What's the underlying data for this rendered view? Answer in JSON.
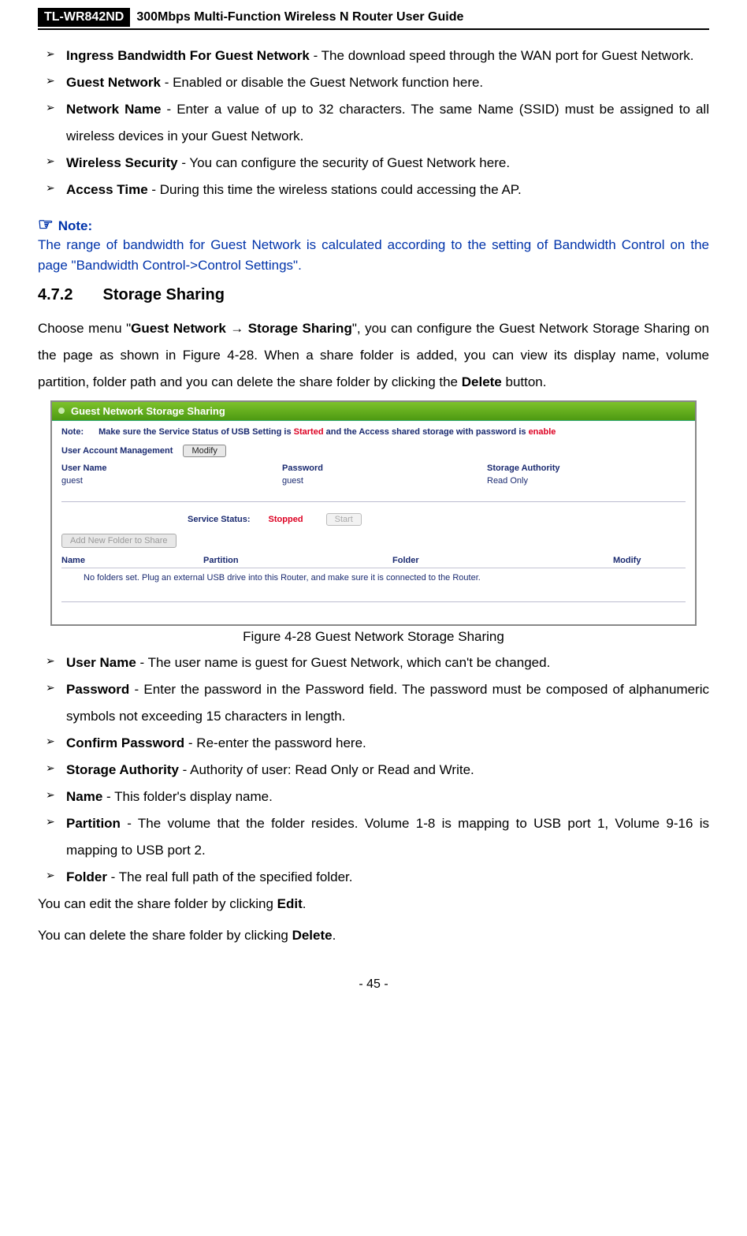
{
  "header": {
    "model": "TL-WR842ND",
    "title": "300Mbps Multi-Function Wireless N Router User Guide"
  },
  "list1": [
    {
      "term": "Ingress Bandwidth For Guest Network",
      "desc": " - The download speed through the WAN port for Guest Network."
    },
    {
      "term": "Guest Network",
      "desc": " - Enabled or disable the Guest Network function here."
    },
    {
      "term": "Network Name",
      "desc": " - Enter a value of up to 32 characters. The same Name (SSID) must be assigned to all wireless devices in your Guest Network."
    },
    {
      "term": "Wireless Security",
      "desc": " - You can configure the security of Guest Network here."
    },
    {
      "term": "Access Time",
      "desc": " - During this time the wireless stations could accessing the AP."
    }
  ],
  "note": {
    "heading": "Note:",
    "body": "The range of bandwidth for Guest Network is calculated according to the setting of Bandwidth Control on the page \"Bandwidth Control->Control Settings\"."
  },
  "section": {
    "num": "4.7.2",
    "title": "Storage Sharing"
  },
  "para1": {
    "pre": "Choose menu \"",
    "boldpath": "Guest Network → Storage Sharing",
    "post1": "\", you can configure the Guest Network Storage Sharing on the page as shown in Figure 4-28. When a share folder is added, you can view its display name, volume partition, folder path and you can delete the share folder by clicking the ",
    "bold2": "Delete",
    "post2": " button."
  },
  "screenshot": {
    "title": "Guest Network Storage Sharing",
    "noteLabel": "Note:",
    "noteText1": "Make sure the Service Status of USB Setting is ",
    "noteRed1": "Started",
    "noteText2": " and the Access shared storage with password is ",
    "noteRed2": "enable",
    "uamLabel": "User Account Management",
    "modifyBtn": "Modify",
    "headers": {
      "user": "User Name",
      "pass": "Password",
      "auth": "Storage Authority"
    },
    "row": {
      "user": "guest",
      "pass": "guest",
      "auth": "Read Only"
    },
    "statusLabel": "Service Status:",
    "statusValue": "Stopped",
    "startBtn": "Start",
    "addBtn": "Add New Folder to Share",
    "table2": {
      "name": "Name",
      "part": "Partition",
      "fold": "Folder",
      "mod": "Modify"
    },
    "emptyMsg": "No folders set. Plug an external USB drive into this Router, and make sure it is connected to the Router."
  },
  "figureCaption": "Figure 4-28 Guest Network Storage Sharing",
  "list2": [
    {
      "term": "User Name",
      "desc": " - The user name is guest for Guest Network, which can't be changed."
    },
    {
      "term": "Password",
      "desc": " - Enter the password in the Password field. The password must be composed of alphanumeric symbols not exceeding 15 characters in length."
    },
    {
      "term": "Confirm Password",
      "desc": " - Re-enter the password here."
    },
    {
      "term": "Storage Authority",
      "desc": " - Authority of user: Read Only or Read and Write."
    },
    {
      "term": "Name",
      "desc": " - This folder's display name."
    },
    {
      "term": "Partition",
      "desc": " - The volume that the folder resides. Volume 1-8 is mapping to USB port 1, Volume 9-16 is mapping to USB port 2."
    },
    {
      "term": "Folder",
      "desc": " - The real full path of the specified folder."
    }
  ],
  "tail": {
    "line1a": "You can edit the share folder by clicking ",
    "line1b": "Edit",
    "line1c": ".",
    "line2a": "You can delete the share folder by clicking ",
    "line2b": "Delete",
    "line2c": "."
  },
  "pageNumber": "- 45 -"
}
